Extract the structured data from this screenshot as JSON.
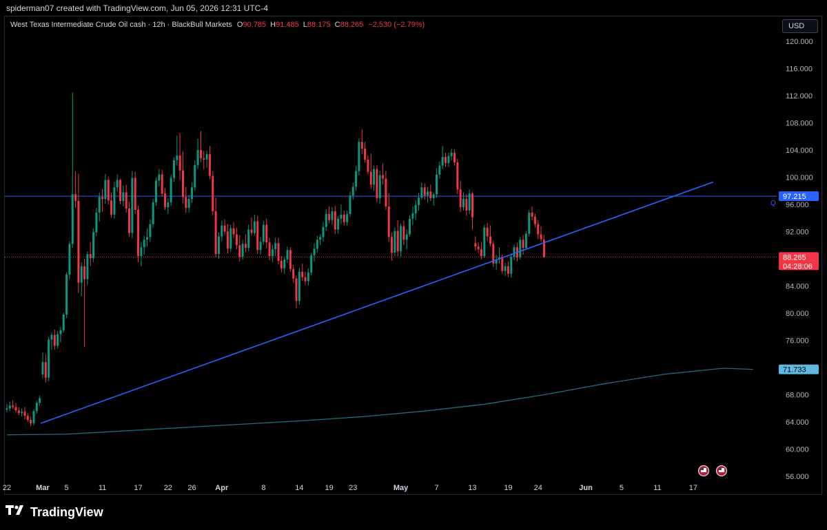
{
  "header": {
    "creator_line": "spiderman07 created with TradingView.com, Jun 05, 2026 12:31 UTC-4"
  },
  "legend": {
    "symbol": "West Texas Intermediate Crude Oil cash · 12h · BlackBull Markets",
    "o_label": "O",
    "o_value": "90.785",
    "h_label": "H",
    "h_value": "91.485",
    "l_label": "L",
    "l_value": "88.175",
    "c_label": "C",
    "c_value": "88.265",
    "change": "−2.530 (−2.79%)"
  },
  "currency_button": "USD",
  "price_badges": {
    "hline": "97.215",
    "last": "88.265",
    "countdown": "04:28:06",
    "ma": "71.733"
  },
  "colors": {
    "up": "#089981",
    "down": "#f23645",
    "trendline": "#2962ff",
    "hline": "#2962ff",
    "ma": "#1f6f80",
    "last_price": "#f23645",
    "ma_badge": "#5fb8e0"
  },
  "chart_data": {
    "type": "candlestick",
    "title": "",
    "xlabel": "",
    "ylabel": "",
    "ylim": [
      54,
      122
    ],
    "y_ticks": [
      "120.000",
      "116.000",
      "112.000",
      "108.000",
      "104.000",
      "100.000",
      "96.000",
      "92.000",
      "88.000",
      "84.000",
      "80.000",
      "76.000",
      "72.000",
      "68.000",
      "64.000",
      "60.000",
      "56.000"
    ],
    "x_ticks": [
      {
        "label": "22",
        "i": 0
      },
      {
        "label": "Mar",
        "i": 12
      },
      {
        "label": "5",
        "i": 20
      },
      {
        "label": "11",
        "i": 32
      },
      {
        "label": "17",
        "i": 44
      },
      {
        "label": "22",
        "i": 54
      },
      {
        "label": "26",
        "i": 62
      },
      {
        "label": "Apr",
        "i": 72
      },
      {
        "label": "8",
        "i": 86
      },
      {
        "label": "14",
        "i": 98
      },
      {
        "label": "19",
        "i": 108
      },
      {
        "label": "23",
        "i": 116
      },
      {
        "label": "May",
        "i": 132
      },
      {
        "label": "7",
        "i": 144
      },
      {
        "label": "13",
        "i": 156
      },
      {
        "label": "19",
        "i": 168
      },
      {
        "label": "24",
        "i": 178
      },
      {
        "label": "Jun",
        "i": 194
      },
      {
        "label": "5",
        "i": 206
      },
      {
        "label": "11",
        "i": 218
      },
      {
        "label": "17",
        "i": 230
      }
    ],
    "candles": [
      [
        65.8,
        66.6,
        65.4,
        66.0
      ],
      [
        66.0,
        67.0,
        65.6,
        66.4
      ],
      [
        66.4,
        67.2,
        65.9,
        66.2
      ],
      [
        66.2,
        66.8,
        65.4,
        65.7
      ],
      [
        65.7,
        66.2,
        65.0,
        65.3
      ],
      [
        65.3,
        66.0,
        64.8,
        65.5
      ],
      [
        65.5,
        66.2,
        64.4,
        64.9
      ],
      [
        64.9,
        65.3,
        64.0,
        64.3
      ],
      [
        64.3,
        64.8,
        63.4,
        63.8
      ],
      [
        63.8,
        65.9,
        63.5,
        65.6
      ],
      [
        65.6,
        67.1,
        65.2,
        66.8
      ],
      [
        66.8,
        67.9,
        66.4,
        67.5
      ],
      [
        71.0,
        74.2,
        70.4,
        72.8
      ],
      [
        72.8,
        74.0,
        69.8,
        70.5
      ],
      [
        70.5,
        76.5,
        70.0,
        76.1
      ],
      [
        76.1,
        77.2,
        74.6,
        76.8
      ],
      [
        76.8,
        77.6,
        74.6,
        75.2
      ],
      [
        75.2,
        77.4,
        74.8,
        76.9
      ],
      [
        76.9,
        78.0,
        75.7,
        77.5
      ],
      [
        77.5,
        80.1,
        77.1,
        79.8
      ],
      [
        79.8,
        86.0,
        79.3,
        85.7
      ],
      [
        85.7,
        90.6,
        85.0,
        90.2
      ],
      [
        90.2,
        112.5,
        89.6,
        97.5
      ],
      [
        97.5,
        100.9,
        95.5,
        96.5
      ],
      [
        96.5,
        100.5,
        83.0,
        84.5
      ],
      [
        84.5,
        87.5,
        82.5,
        86.9
      ],
      [
        86.9,
        88.0,
        75.0,
        85.0
      ],
      [
        85.0,
        89.1,
        84.2,
        88.7
      ],
      [
        88.7,
        90.5,
        86.9,
        88.1
      ],
      [
        88.1,
        92.5,
        87.5,
        91.9
      ],
      [
        91.9,
        95.5,
        91.3,
        94.8
      ],
      [
        94.8,
        97.8,
        93.5,
        97.1
      ],
      [
        97.1,
        98.3,
        94.9,
        96.8
      ],
      [
        96.8,
        100.5,
        96.1,
        99.6
      ],
      [
        99.6,
        100.1,
        96.0,
        96.6
      ],
      [
        96.6,
        97.8,
        94.0,
        94.5
      ],
      [
        94.5,
        99.3,
        93.9,
        98.5
      ],
      [
        98.5,
        100.4,
        97.9,
        99.6
      ],
      [
        99.6,
        99.8,
        96.0,
        96.5
      ],
      [
        96.5,
        98.8,
        95.7,
        97.8
      ],
      [
        97.8,
        98.9,
        94.8,
        95.4
      ],
      [
        95.4,
        96.4,
        91.2,
        91.8
      ],
      [
        91.8,
        100.9,
        91.0,
        99.9
      ],
      [
        99.9,
        100.8,
        94.6,
        95.2
      ],
      [
        95.2,
        95.8,
        87.5,
        88.4
      ],
      [
        88.4,
        90.5,
        86.9,
        89.7
      ],
      [
        89.7,
        91.4,
        88.6,
        90.8
      ],
      [
        90.8,
        92.5,
        89.8,
        91.2
      ],
      [
        91.2,
        93.8,
        90.5,
        93.1
      ],
      [
        93.1,
        96.8,
        92.6,
        96.3
      ],
      [
        96.3,
        99.9,
        95.8,
        99.5
      ],
      [
        99.5,
        101.2,
        98.7,
        100.4
      ],
      [
        100.4,
        101.1,
        97.2,
        97.6
      ],
      [
        97.6,
        98.4,
        95.2,
        95.6
      ],
      [
        95.6,
        96.9,
        94.6,
        96.3
      ],
      [
        96.3,
        100.4,
        95.8,
        99.9
      ],
      [
        99.9,
        102.9,
        99.3,
        102.5
      ],
      [
        102.5,
        106.1,
        101.7,
        103.2
      ],
      [
        103.2,
        106.5,
        99.6,
        101.0
      ],
      [
        101.0,
        103.8,
        96.2,
        97.1
      ],
      [
        97.1,
        98.6,
        94.8,
        95.5
      ],
      [
        95.5,
        97.4,
        94.8,
        96.8
      ],
      [
        96.8,
        99.2,
        96.2,
        98.5
      ],
      [
        98.5,
        102.4,
        98.0,
        101.8
      ],
      [
        101.8,
        105.7,
        101.2,
        104.0
      ],
      [
        104.0,
        106.8,
        102.2,
        102.8
      ],
      [
        102.8,
        103.9,
        101.2,
        102.6
      ],
      [
        102.6,
        103.9,
        101.4,
        103.4
      ],
      [
        103.4,
        104.6,
        99.7,
        100.2
      ],
      [
        100.2,
        100.9,
        94.4,
        95.0
      ],
      [
        95.0,
        97.0,
        88.2,
        88.7
      ],
      [
        88.7,
        91.9,
        88.0,
        91.3
      ],
      [
        91.3,
        93.6,
        90.6,
        92.9
      ],
      [
        92.9,
        93.8,
        91.5,
        92.0
      ],
      [
        92.0,
        93.1,
        88.8,
        89.5
      ],
      [
        89.5,
        93.0,
        89.0,
        92.5
      ],
      [
        92.5,
        93.4,
        91.0,
        91.6
      ],
      [
        91.6,
        92.6,
        89.4,
        90.0
      ],
      [
        90.0,
        91.5,
        87.6,
        88.3
      ],
      [
        88.3,
        90.8,
        87.9,
        90.2
      ],
      [
        90.2,
        91.6,
        89.0,
        89.6
      ],
      [
        89.6,
        93.0,
        89.1,
        92.3
      ],
      [
        92.3,
        94.1,
        91.4,
        91.8
      ],
      [
        91.8,
        94.5,
        91.4,
        93.5
      ],
      [
        93.5,
        94.3,
        88.7,
        89.3
      ],
      [
        89.3,
        91.2,
        88.6,
        90.5
      ],
      [
        90.5,
        93.6,
        90.1,
        93.0
      ],
      [
        93.0,
        93.9,
        89.5,
        90.4
      ],
      [
        90.4,
        91.1,
        87.8,
        88.4
      ],
      [
        88.4,
        90.1,
        87.5,
        89.4
      ],
      [
        89.4,
        91.1,
        88.4,
        90.3
      ],
      [
        90.3,
        91.1,
        87.2,
        87.7
      ],
      [
        87.7,
        88.4,
        86.0,
        86.6
      ],
      [
        86.6,
        88.3,
        85.8,
        87.9
      ],
      [
        87.9,
        89.8,
        87.4,
        89.3
      ],
      [
        89.3,
        89.7,
        86.1,
        86.5
      ],
      [
        86.5,
        87.1,
        84.5,
        85.1
      ],
      [
        85.1,
        85.5,
        80.7,
        81.8
      ],
      [
        81.8,
        86.7,
        81.2,
        86.1
      ],
      [
        86.1,
        87.3,
        84.8,
        85.3
      ],
      [
        85.3,
        86.1,
        84.2,
        84.7
      ],
      [
        84.7,
        86.6,
        84.1,
        86.0
      ],
      [
        86.0,
        88.9,
        85.6,
        88.5
      ],
      [
        88.5,
        90.3,
        87.6,
        89.5
      ],
      [
        89.5,
        91.4,
        88.9,
        90.8
      ],
      [
        90.8,
        91.6,
        90.0,
        91.2
      ],
      [
        91.2,
        93.4,
        90.5,
        92.7
      ],
      [
        92.7,
        95.3,
        92.1,
        94.6
      ],
      [
        94.6,
        95.7,
        93.2,
        93.7
      ],
      [
        93.7,
        95.6,
        93.0,
        95.0
      ],
      [
        95.0,
        95.8,
        91.6,
        92.3
      ],
      [
        92.3,
        94.3,
        91.7,
        93.9
      ],
      [
        93.9,
        96.0,
        93.1,
        94.5
      ],
      [
        94.5,
        95.1,
        92.9,
        93.4
      ],
      [
        93.4,
        95.1,
        92.9,
        94.6
      ],
      [
        94.6,
        97.9,
        94.2,
        97.3
      ],
      [
        97.3,
        99.2,
        96.7,
        98.6
      ],
      [
        98.6,
        101.6,
        98.0,
        100.9
      ],
      [
        100.9,
        105.7,
        100.3,
        105.2
      ],
      [
        105.2,
        107.1,
        103.4,
        104.2
      ],
      [
        104.2,
        105.2,
        102.1,
        102.6
      ],
      [
        102.6,
        103.2,
        100.4,
        100.8
      ],
      [
        100.8,
        103.5,
        98.3,
        98.9
      ],
      [
        98.9,
        101.7,
        98.0,
        101.2
      ],
      [
        101.2,
        101.8,
        96.3,
        96.9
      ],
      [
        96.9,
        101.0,
        96.1,
        100.3
      ],
      [
        100.3,
        102.0,
        98.9,
        99.8
      ],
      [
        99.8,
        101.0,
        95.2,
        95.7
      ],
      [
        95.7,
        97.6,
        90.5,
        91.2
      ],
      [
        91.2,
        91.9,
        87.7,
        88.9
      ],
      [
        88.9,
        92.6,
        88.4,
        92.1
      ],
      [
        92.1,
        93.7,
        88.4,
        89.1
      ],
      [
        89.1,
        93.2,
        88.3,
        92.8
      ],
      [
        92.8,
        93.6,
        90.0,
        90.8
      ],
      [
        90.8,
        92.3,
        89.4,
        91.6
      ],
      [
        91.6,
        94.4,
        91.2,
        93.9
      ],
      [
        93.9,
        95.7,
        93.0,
        94.7
      ],
      [
        94.7,
        96.6,
        93.7,
        95.9
      ],
      [
        95.9,
        97.7,
        95.1,
        97.0
      ],
      [
        97.0,
        99.2,
        96.7,
        98.5
      ],
      [
        98.5,
        99.1,
        96.7,
        97.3
      ],
      [
        97.3,
        98.6,
        96.3,
        97.9
      ],
      [
        97.9,
        98.9,
        96.5,
        96.9
      ],
      [
        96.9,
        97.8,
        95.8,
        97.5
      ],
      [
        97.5,
        101.3,
        97.0,
        100.4
      ],
      [
        100.4,
        102.3,
        99.8,
        101.7
      ],
      [
        101.7,
        104.6,
        101.2,
        103.0
      ],
      [
        103.0,
        103.6,
        101.5,
        102.1
      ],
      [
        102.1,
        103.6,
        101.5,
        103.1
      ],
      [
        103.1,
        104.2,
        102.5,
        103.6
      ],
      [
        103.6,
        104.1,
        101.7,
        102.2
      ],
      [
        102.2,
        102.7,
        97.5,
        98.2
      ],
      [
        98.2,
        99.5,
        94.9,
        95.6
      ],
      [
        95.6,
        97.8,
        95.1,
        96.8
      ],
      [
        96.8,
        97.5,
        94.3,
        95.1
      ],
      [
        95.1,
        98.2,
        94.6,
        97.6
      ],
      [
        97.6,
        97.8,
        92.3,
        94.1
      ],
      [
        90.3,
        91.3,
        89.2,
        89.8
      ],
      [
        89.8,
        90.4,
        88.9,
        89.4
      ],
      [
        89.4,
        90.5,
        87.9,
        88.4
      ],
      [
        88.4,
        93.0,
        88.1,
        92.6
      ],
      [
        92.6,
        93.3,
        90.6,
        91.3
      ],
      [
        91.3,
        92.9,
        89.8,
        90.2
      ],
      [
        90.2,
        90.7,
        86.8,
        87.3
      ],
      [
        87.3,
        88.6,
        86.4,
        87.9
      ],
      [
        87.9,
        89.7,
        87.3,
        88.2
      ],
      [
        88.2,
        88.6,
        85.8,
        86.2
      ],
      [
        86.2,
        87.4,
        85.5,
        86.9
      ],
      [
        86.9,
        87.6,
        85.3,
        85.8
      ],
      [
        85.8,
        88.8,
        85.2,
        88.3
      ],
      [
        88.3,
        90.1,
        87.8,
        89.7
      ],
      [
        89.7,
        90.4,
        87.6,
        88.2
      ],
      [
        88.2,
        91.2,
        87.9,
        90.8
      ],
      [
        90.8,
        91.5,
        88.6,
        89.6
      ],
      [
        89.6,
        92.1,
        89.3,
        91.7
      ],
      [
        91.7,
        95.2,
        91.3,
        94.8
      ],
      [
        94.8,
        95.7,
        93.7,
        94.2
      ],
      [
        94.2,
        94.6,
        92.6,
        93.1
      ],
      [
        93.1,
        93.7,
        90.9,
        91.6
      ],
      [
        91.6,
        92.8,
        90.5,
        90.9
      ],
      [
        90.785,
        91.485,
        88.175,
        88.265
      ]
    ],
    "horizontal_line": 97.215,
    "last_price": 88.265,
    "ma_series": [
      [
        0,
        62.1
      ],
      [
        20,
        62.2
      ],
      [
        40,
        62.7
      ],
      [
        60,
        63.2
      ],
      [
        80,
        63.7
      ],
      [
        100,
        64.2
      ],
      [
        120,
        64.8
      ],
      [
        140,
        65.6
      ],
      [
        160,
        66.6
      ],
      [
        180,
        68.0
      ],
      [
        200,
        69.6
      ],
      [
        220,
        71.0
      ],
      [
        240,
        71.9
      ],
      [
        250,
        71.733
      ]
    ],
    "trendline": [
      [
        -2,
        63.8
      ],
      [
        268,
        99.3
      ]
    ]
  }
}
